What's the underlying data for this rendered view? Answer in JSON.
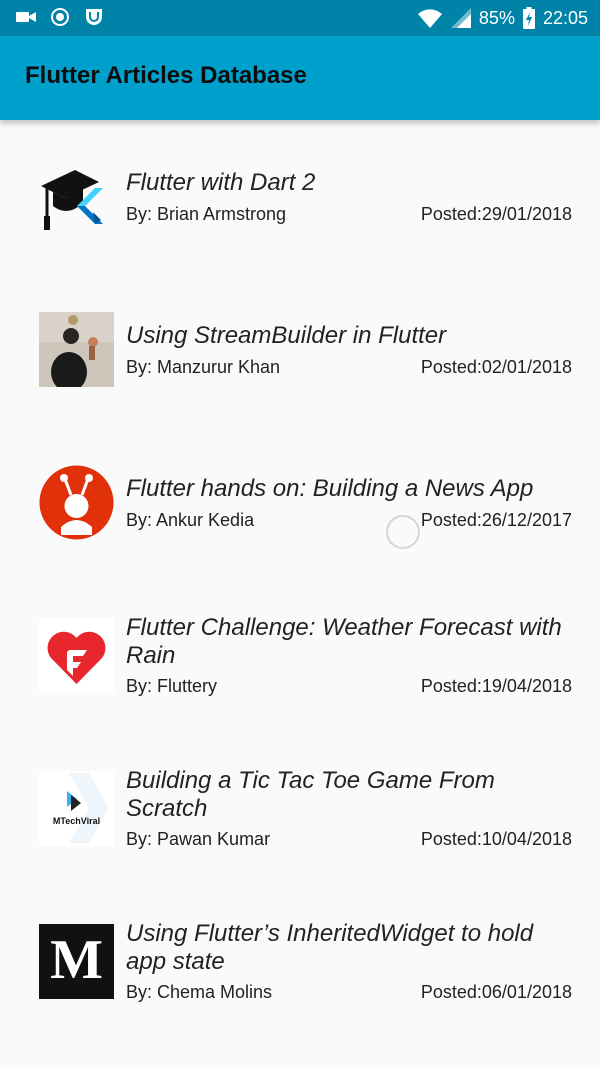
{
  "statusbar": {
    "battery": "85%",
    "time": "22:05",
    "icons": [
      "video-icon",
      "record-icon",
      "shield-app-icon",
      "wifi-icon",
      "signal-icon",
      "battery-icon"
    ]
  },
  "appbar": {
    "title": "Flutter Articles Database"
  },
  "articles": [
    {
      "title": "Flutter with Dart 2",
      "author": "By: Brian Armstrong",
      "posted": "Posted:29/01/2018",
      "thumb": "graduation-cap-flutter-logo"
    },
    {
      "title": "Using StreamBuilder in Flutter",
      "author": "By: Manzurur Khan",
      "posted": "Posted:02/01/2018",
      "thumb": "author-photo"
    },
    {
      "title": "Flutter hands on: Building a News App",
      "author": "By: Ankur Kedia",
      "posted": "Posted:26/12/2017",
      "thumb": "robot-logo"
    },
    {
      "title": "Flutter Challenge: Weather Forecast with Rain",
      "author": "By: Fluttery",
      "posted": "Posted:19/04/2018",
      "thumb": "fluttery-heart-logo"
    },
    {
      "title": "Building a Tic Tac Toe Game From Scratch",
      "author": "By: Pawan Kumar",
      "posted": "Posted:10/04/2018",
      "thumb": "mtechviral-logo",
      "thumb_text": "MTechViral"
    },
    {
      "title": "Using Flutter’s InheritedWidget to hold app state",
      "author": "By: Chema Molins",
      "posted": "Posted:06/01/2018",
      "thumb": "medium-logo",
      "thumb_text": "M"
    }
  ],
  "colors": {
    "statusbar": "#0083a8",
    "appbar": "#00a0cd",
    "background": "#fafafa"
  }
}
